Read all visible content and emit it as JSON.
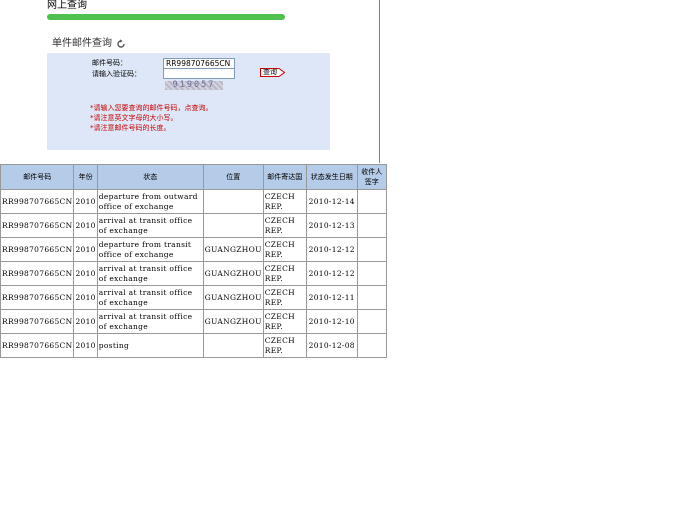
{
  "page_title": "网上查询",
  "section_title": "单件邮件查询",
  "form": {
    "mail_no_label": "邮件号码：",
    "mail_no_value": "RR998707665CN",
    "captcha_label": "请输入验证码：",
    "captcha_value": "",
    "captcha_image_text": "919057",
    "query_button": "查询",
    "notes": [
      "*请输入您要查询的邮件号码，点查询。",
      "*请注意英文字母的大小写。",
      "*请注意邮件号码的长度。"
    ]
  },
  "table": {
    "headers": [
      "邮件号码",
      "年份",
      "状态",
      "位置",
      "邮件寄达国",
      "状态发生日期",
      "收件人签字"
    ],
    "rows": [
      [
        "RR998707665CN",
        "2010",
        "departure from outward office of exchange",
        "",
        "CZECH REP.",
        "2010-12-14",
        ""
      ],
      [
        "RR998707665CN",
        "2010",
        "arrival at transit office of exchange",
        "",
        "CZECH REP.",
        "2010-12-13",
        ""
      ],
      [
        "RR998707665CN",
        "2010",
        "departure from transit office of exchange",
        "GUANGZHOU",
        "CZECH REP.",
        "2010-12-12",
        ""
      ],
      [
        "RR998707665CN",
        "2010",
        "arrival at transit office of exchange",
        "GUANGZHOU",
        "CZECH REP.",
        "2010-12-12",
        ""
      ],
      [
        "RR998707665CN",
        "2010",
        "arrival at transit office of exchange",
        "GUANGZHOU",
        "CZECH REP.",
        "2010-12-11",
        ""
      ],
      [
        "RR998707665CN",
        "2010",
        "arrival at transit office of exchange",
        "GUANGZHOU",
        "CZECH REP.",
        "2010-12-10",
        ""
      ],
      [
        "RR998707665CN",
        "2010",
        "posting",
        "",
        "CZECH REP.",
        "2010-12-08",
        ""
      ]
    ]
  },
  "colors": {
    "title_bar": "#4fc14f",
    "form_bg": "#dde7f7",
    "header_bg": "#b5cce8",
    "note_text": "#cc0000"
  },
  "icons": {
    "refresh": "refresh-icon",
    "query_arrow": "arrow-button-icon"
  }
}
